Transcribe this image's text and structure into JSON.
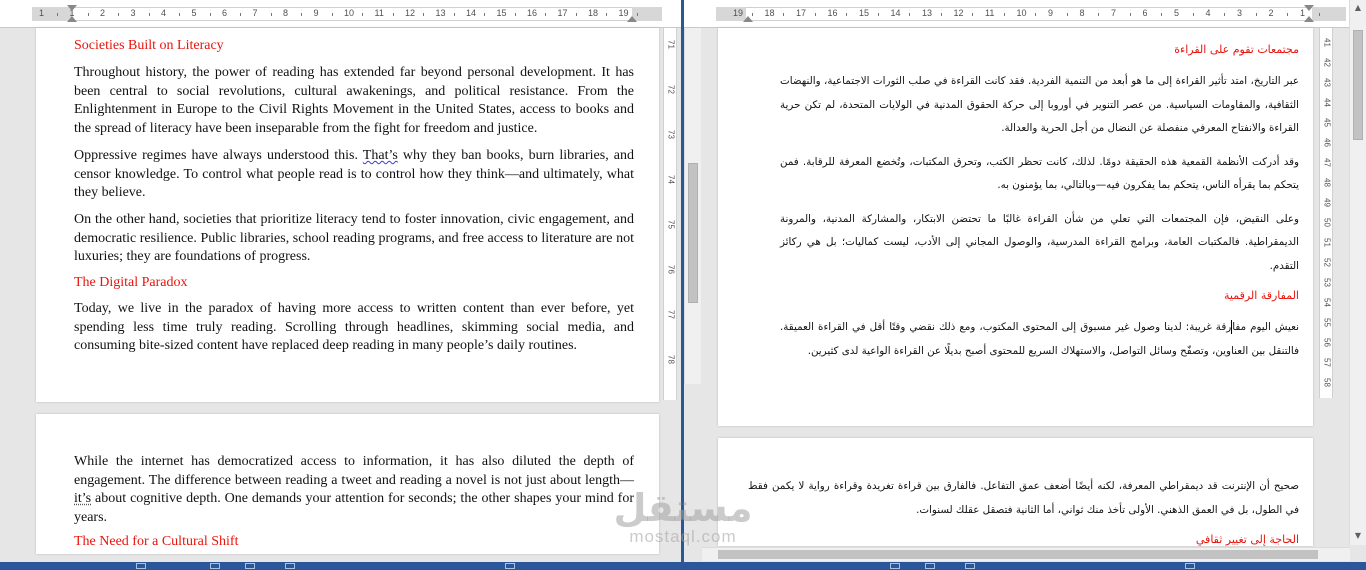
{
  "left_ruler": {
    "ticks": [
      "1",
      "1",
      "2",
      "3",
      "4",
      "5",
      "6",
      "7",
      "8",
      "9",
      "10",
      "11",
      "12",
      "13",
      "14",
      "15",
      "16",
      "17",
      "18",
      "19"
    ]
  },
  "right_ruler": {
    "ticks": [
      "19",
      "18",
      "17",
      "16",
      "15",
      "14",
      "13",
      "12",
      "11",
      "10",
      "9",
      "8",
      "7",
      "6",
      "5",
      "4",
      "3",
      "2",
      "1"
    ]
  },
  "left_vruler": [
    "71",
    "72",
    "73",
    "74",
    "75",
    "76",
    "77",
    "78"
  ],
  "right_vruler": [
    "41",
    "42",
    "43",
    "44",
    "45",
    "46",
    "47",
    "48",
    "49",
    "50",
    "51",
    "52",
    "53",
    "54",
    "55",
    "56",
    "57",
    "58"
  ],
  "english": {
    "h1": "Societies Built on Literacy",
    "p1": "Throughout history, the power of reading has extended far beyond personal development. It has been central to social revolutions, cultural awakenings, and political resistance. From the Enlightenment in Europe to the Civil Rights Movement in the United States, access to books and the spread of literacy have been inseparable from the fight for freedom and justice.",
    "p2_a": "Oppressive regimes have always understood this. ",
    "p2_b": "That’s",
    "p2_c": " why they ban books, burn libraries, and censor knowledge. To control what people read is to control how they think—and ultimately, what they believe.",
    "p3": "On the other hand, societies that prioritize literacy tend to foster innovation, civic engagement, and democratic resilience. Public libraries, school reading programs, and free access to literature are not luxuries; they are foundations of progress.",
    "h2": "The Digital Paradox",
    "p4": "Today, we live in the paradox of having more access to written content than ever before, yet spending less time truly reading. Scrolling through headlines, skimming social media, and consuming bite-sized content have replaced deep reading in many people’s daily routines.",
    "p5_a": "While the internet has democratized access to information, it has also diluted the depth of engagement. The difference between reading a tweet and reading a novel is not just about length—",
    "p5_b": "it’s",
    "p5_c": " about cognitive depth. One demands your attention for seconds; the other shapes your mind for years.",
    "h3": "The Need for a Cultural Shift"
  },
  "arabic": {
    "h1": "مجتمعات تقوم على القراءة",
    "p1": "عبر التاريخ، امتد تأثير القراءة إلى ما هو أبعد من التنمية الفردية. فقد كانت القراءة في صلب الثورات الاجتماعية، والنهضات الثقافية، والمقاومات السياسية. من عصر التنوير في أوروبا إلى حركة الحقوق المدنية في الولايات المتحدة، لم تكن حرية القراءة والانفتاح المعرفي منفصلة عن النضال من أجل الحرية والعدالة.",
    "p2": "وقد أدركت الأنظمة القمعية هذه الحقيقة دومًا. لذلك، كانت تحظر الكتب، وتحرق المكتبات، وتُخضع المعرفة للرقابة. فمن يتحكم بما يقرأه الناس، يتحكم بما يفكرون فيه—وبالتالي، بما يؤمنون به.",
    "p3": "وعلى النقيض، فإن المجتمعات التي تعلي من شأن القراءة غالبًا ما تحتضن الابتكار، والمشاركة المدنية، والمرونة الديمقراطية. فالمكتبات العامة، وبرامج القراءة المدرسية، والوصول المجاني إلى الأدب، ليست كماليات؛ بل هي ركائز التقدم.",
    "h2": "المفارقة الرقمية",
    "p4_a": "نعيش اليوم مفا",
    "p4_b": "رقة غريبة: لدينا وصول غير مسبوق إلى المحتوى المكتوب، ومع ذلك نقضي وقتًا أقل في القراءة العميقة. فالتنقل بين العناوين، وتصفّح وسائل التواصل، والاستهلاك السريع للمحتوى أصبح بديلًا عن القراءة الواعية لدى كثيرين.",
    "p5": "صحيح أن الإنترنت قد ديمقراطي المعرفة، لكنه أيضًا أضعف عمق التفاعل. فالفارق بين قراءة تغريدة وقراءة رواية لا يكمن فقط في الطول، بل في العمق الذهني. الأولى تأخذ منك ثواني، أما الثانية فتصقل عقلك لسنوات.",
    "h3": "الحاجة إلى تغيير ثقافي"
  },
  "watermark": {
    "logo": "مستقل",
    "sub": "mostaql.com"
  },
  "colors": {
    "heading": "#e8140c",
    "status_bar": "#2b579a"
  }
}
